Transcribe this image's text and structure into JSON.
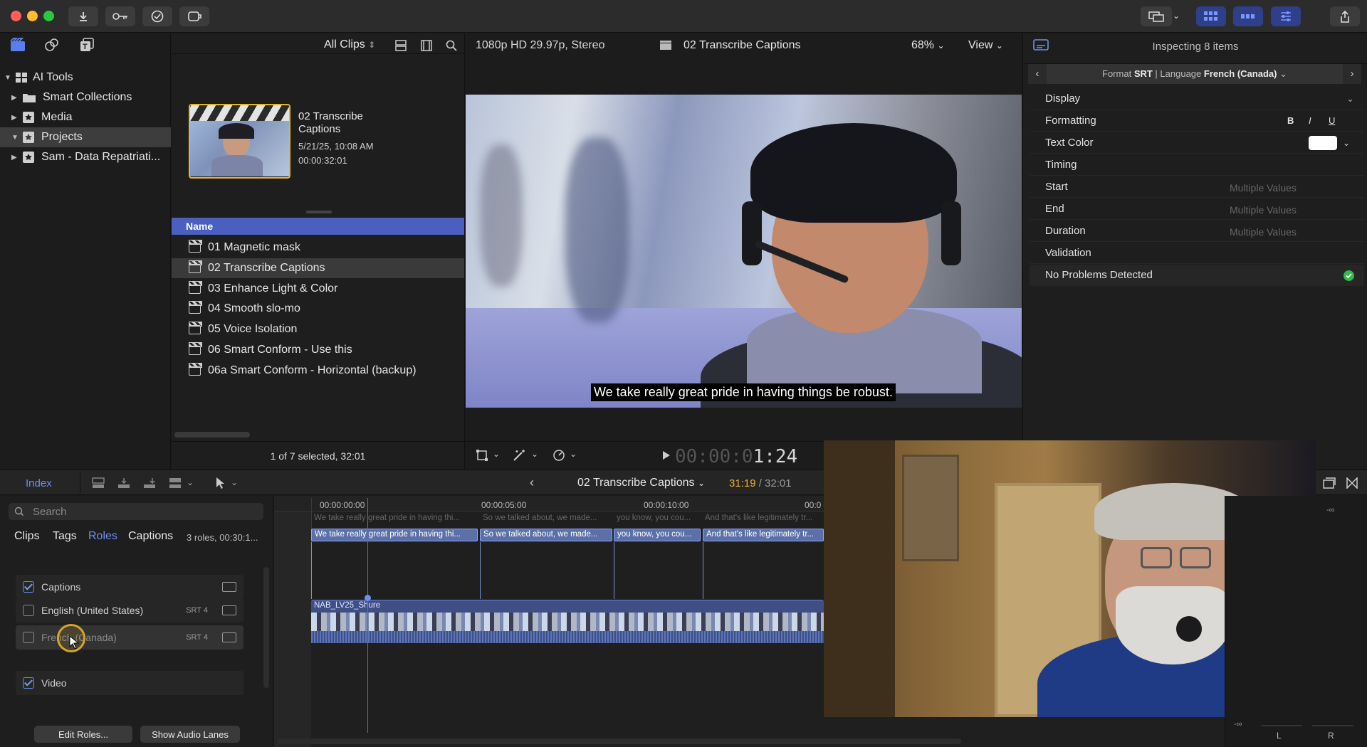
{
  "library": {
    "items": [
      {
        "label": "AI Tools",
        "selected": false
      },
      {
        "label": "Smart Collections",
        "selected": false
      },
      {
        "label": "Media",
        "selected": false
      },
      {
        "label": "Projects",
        "selected": true
      },
      {
        "label": "Sam - Data Repatriati..."
      }
    ]
  },
  "browser": {
    "filter_label": "All Clips",
    "thumb": {
      "title": "02 Transcribe Captions",
      "date": "5/21/25, 10:08 AM",
      "duration": "00:00:32:01"
    },
    "column_header": "Name",
    "rows": [
      {
        "label": "01 Magnetic mask"
      },
      {
        "label": "02 Transcribe Captions",
        "selected": true
      },
      {
        "label": "03 Enhance Light & Color"
      },
      {
        "label": "04 Smooth slo-mo"
      },
      {
        "label": "05 Voice Isolation"
      },
      {
        "label": "06 Smart Conform - Use this"
      },
      {
        "label": "06a Smart Conform - Horizontal (backup)"
      }
    ],
    "status": "1 of 7 selected, 32:01"
  },
  "viewer": {
    "format": "1080p HD 29.97p, Stereo",
    "title": "02 Transcribe Captions",
    "zoom": "68%",
    "view_label": "View",
    "caption": "We take really great pride in having things be robust.",
    "timecode_dim": "00:00:0",
    "timecode_bright": "1:24"
  },
  "inspector": {
    "header": "Inspecting 8 items",
    "format_prefix": "Format ",
    "format_value": "SRT",
    "language_prefix": " | Language ",
    "language_value": "French (Canada)",
    "rows": [
      {
        "label": "Display"
      },
      {
        "label": "Formatting"
      },
      {
        "label": "Text Color"
      },
      {
        "label": "Timing"
      },
      {
        "label": "Start",
        "value": "Multiple Values"
      },
      {
        "label": "End",
        "value": "Multiple Values"
      },
      {
        "label": "Duration",
        "value": "Multiple Values"
      },
      {
        "label": "Validation"
      },
      {
        "label": "No Problems Detected"
      }
    ],
    "bold": "B",
    "italic": "I",
    "underline": "U",
    "text_color": "#ffffff"
  },
  "timeline": {
    "index_label": "Index",
    "project": "02 Transcribe Captions",
    "time_current": "31:19",
    "time_total": "/ 32:01",
    "ruler": [
      "00:00:00:00",
      "00:00:05:00",
      "00:00:10:00",
      "00:0"
    ],
    "captions": [
      "We take really great pride in having thi...",
      "So we talked about, we made...",
      "you know, you cou...",
      "And that's like legitimately tr..."
    ],
    "ghost_captions": [
      "We take really great pride in having thi...",
      "So we talked about, we made...",
      "you know, you cou...",
      "And that's like legitimately tr..."
    ],
    "clip_name": "NAB_LV25_Shure",
    "meter_top": "-∞",
    "meter_bottom": "-∞",
    "meter_l": "L",
    "meter_r": "R"
  },
  "index": {
    "search_placeholder": "Search",
    "tabs": [
      "Clips",
      "Tags",
      "Roles",
      "Captions"
    ],
    "active_tab": "Roles",
    "summary": "3 roles, 00:30:1...",
    "roles": [
      {
        "label": "Captions",
        "checked": true
      },
      {
        "label": "English (United States)",
        "checked": false,
        "badge": "SRT 4"
      },
      {
        "label": "French (Canada)",
        "checked": false,
        "badge": "SRT 4"
      },
      {
        "label": "Video",
        "checked": true
      }
    ],
    "edit_roles": "Edit Roles...",
    "show_audio_lanes": "Show Audio Lanes"
  },
  "colors": {
    "accent": "#4a5fc0",
    "selection_yellow": "#e8b32e",
    "check_green": "#2fbd4c"
  }
}
